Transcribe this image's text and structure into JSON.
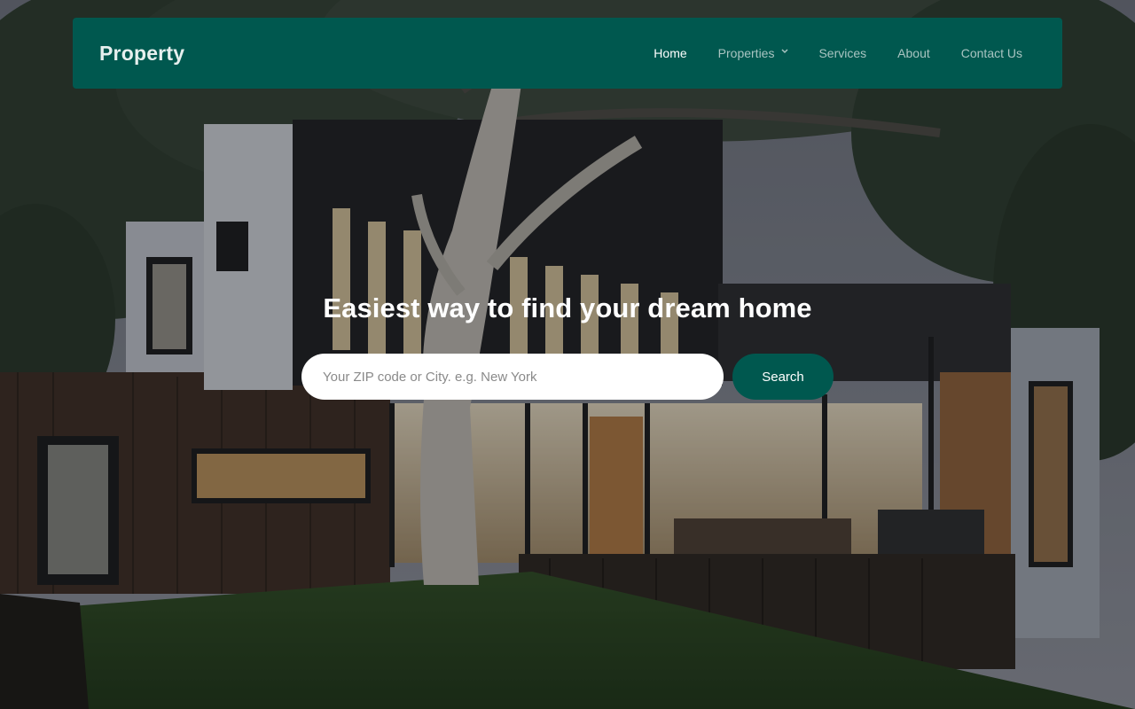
{
  "navbar": {
    "brand": "Property",
    "items": [
      {
        "label": "Home",
        "active": true
      },
      {
        "label": "Properties",
        "has_dropdown": true
      },
      {
        "label": "Services"
      },
      {
        "label": "About"
      },
      {
        "label": "Contact Us"
      }
    ]
  },
  "hero": {
    "headline": "Easiest way to find your dream home",
    "search": {
      "placeholder": "Your ZIP code or City. e.g. New York",
      "value": "",
      "button_label": "Search"
    }
  },
  "colors": {
    "brand_primary": "#00584f",
    "nav_active": "#ffffff",
    "nav_inactive": "#a9c4c1"
  },
  "icons": {
    "properties_dropdown": "chevron-down-icon"
  }
}
